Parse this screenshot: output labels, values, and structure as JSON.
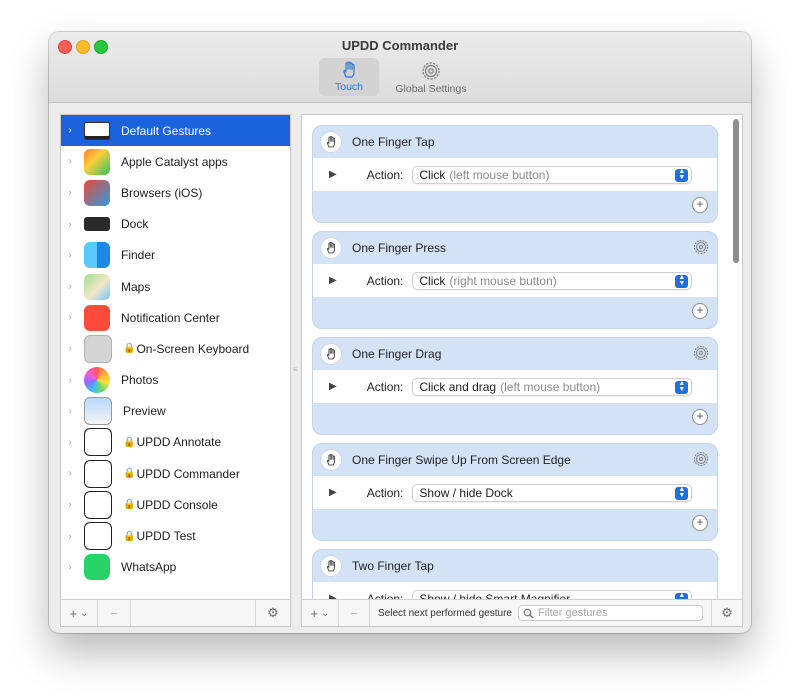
{
  "window": {
    "title": "UPDD Commander"
  },
  "toolbar": {
    "tabs": [
      {
        "label": "Touch",
        "icon": "hand-icon",
        "selected": true
      },
      {
        "label": "Global Settings",
        "icon": "gear-icon",
        "selected": false
      }
    ]
  },
  "sidebar": {
    "apps": [
      {
        "label": "Default Gestures",
        "icon": "monitor-icon",
        "locked": false,
        "selected": true
      },
      {
        "label": "Apple Catalyst apps",
        "icon": "catalyst-icon",
        "locked": false
      },
      {
        "label": "Browsers (iOS)",
        "icon": "browsers-icon",
        "locked": false
      },
      {
        "label": "Dock",
        "icon": "dock-icon",
        "locked": false
      },
      {
        "label": "Finder",
        "icon": "finder-icon",
        "locked": false
      },
      {
        "label": "Maps",
        "icon": "maps-icon",
        "locked": false
      },
      {
        "label": "Notification Center",
        "icon": "notification-icon",
        "locked": false
      },
      {
        "label": "On-Screen Keyboard",
        "icon": "keyboard-icon",
        "locked": true
      },
      {
        "label": "Photos",
        "icon": "photos-icon",
        "locked": false
      },
      {
        "label": "Preview",
        "icon": "preview-icon",
        "locked": false
      },
      {
        "label": "UPDD Annotate",
        "icon": "annotate-icon",
        "locked": true
      },
      {
        "label": "UPDD Commander",
        "icon": "commander-icon",
        "locked": true
      },
      {
        "label": "UPDD Console",
        "icon": "console-icon",
        "locked": true
      },
      {
        "label": "UPDD Test",
        "icon": "test-icon",
        "locked": true
      },
      {
        "label": "WhatsApp",
        "icon": "whatsapp-icon",
        "locked": false
      }
    ],
    "bottom": {
      "add": "+",
      "add_menu": "⌄",
      "remove": "−",
      "gear": "⚙"
    }
  },
  "gestures": [
    {
      "title": "One Finger Tap",
      "action_label": "Action:",
      "action": "Click",
      "hint": "(left mouse button)",
      "has_gear": false
    },
    {
      "title": "One Finger Press",
      "action_label": "Action:",
      "action": "Click",
      "hint": "(right mouse button)",
      "has_gear": true
    },
    {
      "title": "One Finger Drag",
      "action_label": "Action:",
      "action": "Click and drag",
      "hint": "(left mouse button)",
      "has_gear": true
    },
    {
      "title": "One Finger Swipe Up From Screen Edge",
      "action_label": "Action:",
      "action": "Show / hide Dock",
      "hint": "",
      "has_gear": true
    },
    {
      "title": "Two Finger Tap",
      "action_label": "Action:",
      "action": "Show / hide Smart Magnifier",
      "hint": "",
      "has_gear": false
    }
  ],
  "main_bottom": {
    "add": "+",
    "add_menu": "⌄",
    "remove": "−",
    "select_next": "Select next performed gesture",
    "filter_placeholder": "Filter gestures",
    "gear": "⚙"
  },
  "colors": {
    "accent": "#1b62dd",
    "card": "#d4e2f6",
    "stepper": "#1f6fe0"
  }
}
